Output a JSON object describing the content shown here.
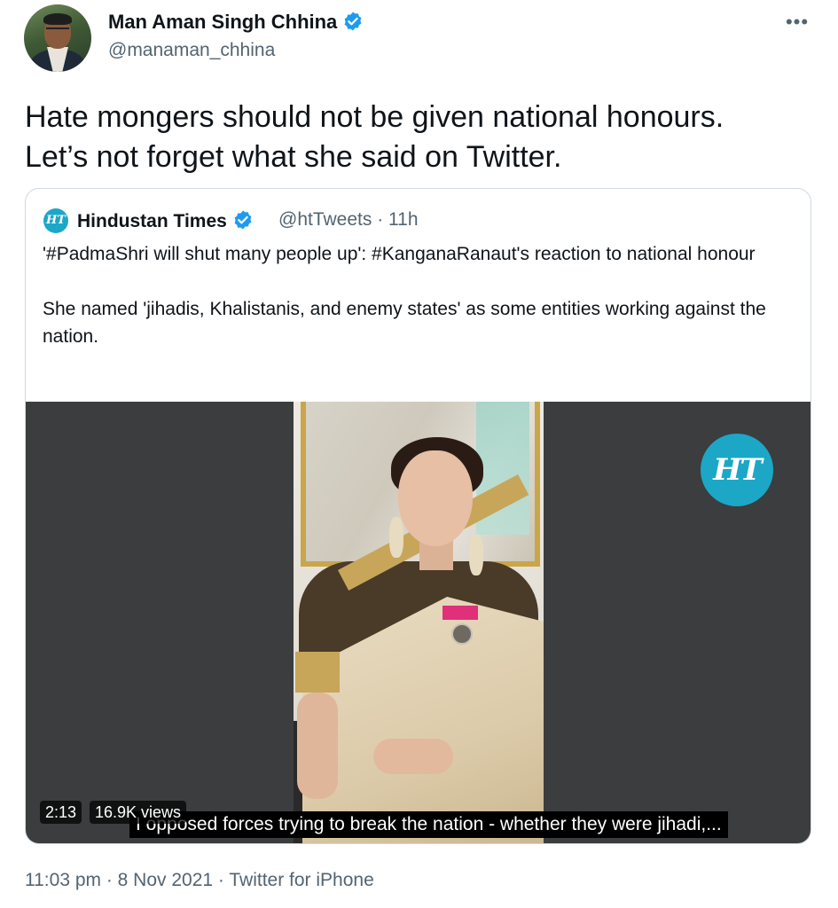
{
  "author": {
    "name": "Man Aman Singh Chhina",
    "handle": "@manaman_chhina"
  },
  "tweet": {
    "line1": "Hate mongers should not be given national honours.",
    "line2": "Let’s not forget what she said on Twitter."
  },
  "quoted": {
    "logo_text": "HT",
    "name": "Hindustan Times",
    "handle_time": "@htTweets · 11h",
    "paragraph1": "'#PadmaShri will shut many people up': #KanganaRanaut's reaction to national honour",
    "paragraph2": "She named 'jihadis, Khalistanis, and enemy states' as some entities working against the nation."
  },
  "video": {
    "logo_text": "HT",
    "duration": "2:13",
    "views": "16.9K views",
    "subtitle": "I opposed forces trying to break the nation - whether they were jihadi,..."
  },
  "meta": {
    "timestamp": "11:03 pm · 8 Nov 2021 · Twitter for iPhone"
  },
  "colors": {
    "verified": "#1d9bf0",
    "ht_brand": "#1ca7c7",
    "secondary_text": "#536471",
    "border": "#cfd9de"
  }
}
